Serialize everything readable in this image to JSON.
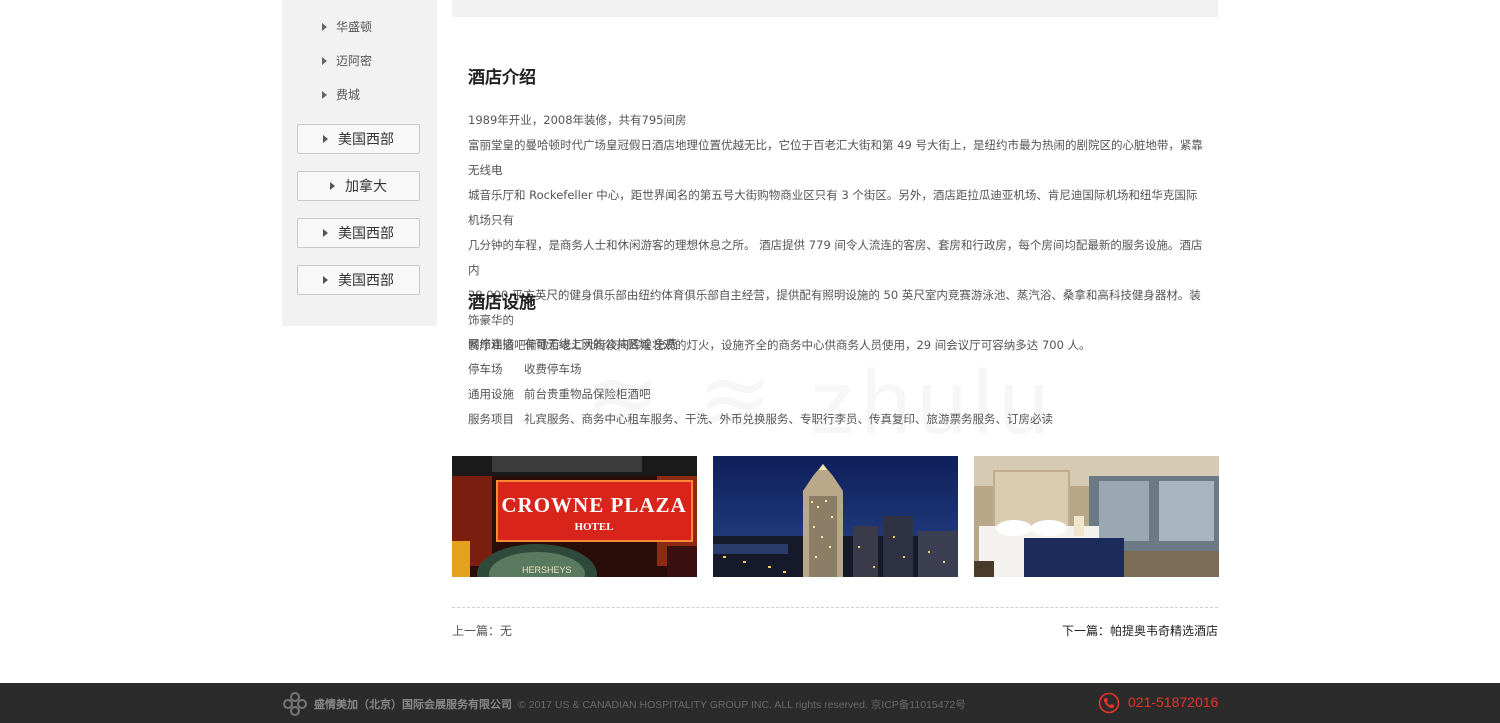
{
  "sidebar": {
    "sub_items": [
      "华盛顿",
      "迈阿密",
      "费城"
    ],
    "region_buttons": [
      "美国西部",
      "加拿大",
      "美国西部",
      "美国西部"
    ]
  },
  "main": {
    "intro_title": "酒店介绍",
    "intro_lines": [
      "1989年开业，2008年装修，共有795间房",
      "富丽堂皇的曼哈顿时代广场皇冠假日酒店地理位置优越无比，它位于百老汇大街和第  49  号大街上，是纽约市最为热闹的剧院区的心脏地带，紧靠无线电",
      "城音乐厅和 Rockefeller 中心，距世界闻名的第五号大街购物商业区只有 3 个街区。另外，酒店距拉瓜迪亚机场、肯尼迪国际机场和纽华克国际机场只有",
      "几分钟的车程，是商务人士和休闲游客的理想休息之所。    酒店提供    779    间令人流连的客房、套房和行政房，每个房间均配最新的服务设施。酒店内",
      "29,000 平方英尺的健身俱乐部由纽约体育俱乐部自主经营，提供配有照明设施的 50 英尺室内竞赛游泳池、蒸汽浴、桑拿和高科技健身器材。装饰豪华的",
      "餐厅和酒吧俯瞰百老汇大街夜间辉煌壮观的灯火，设施齐全的商务中心供商务人员使用，29 间会议厅可容纳多达 700 人。"
    ],
    "facilities_title": "酒店设施",
    "facilities": [
      {
        "label": "网络连接",
        "value": "有可无线上网的公共区域 免费"
      },
      {
        "label": "停车场",
        "value": "收费停车场"
      },
      {
        "label": "通用设施",
        "value": "前台贵重物品保险柜酒吧"
      },
      {
        "label": "服务项目",
        "value": "礼宾服务、商务中心租车服务、干洗、外币兑换服务、专职行李员、传真复印、旅游票务服务、订房必读"
      }
    ],
    "photos": {
      "sign_line1": "CROWNE PLAZA",
      "sign_line2": "HOTEL",
      "sign_small": "HERSHEYS"
    },
    "prev_label": "上一篇：无",
    "next_label": "下一篇：帕提奥韦奇精选酒店"
  },
  "footer": {
    "company": "盛情美加（北京）国际会展服务有限公司",
    "copyright": "© 2017 US & CANADIAN HOSPITALITY GROUP INC. ALL rights reserved. 京ICP备11015472号",
    "phone": "021-51872016",
    "phone_color": "#e8332a"
  }
}
